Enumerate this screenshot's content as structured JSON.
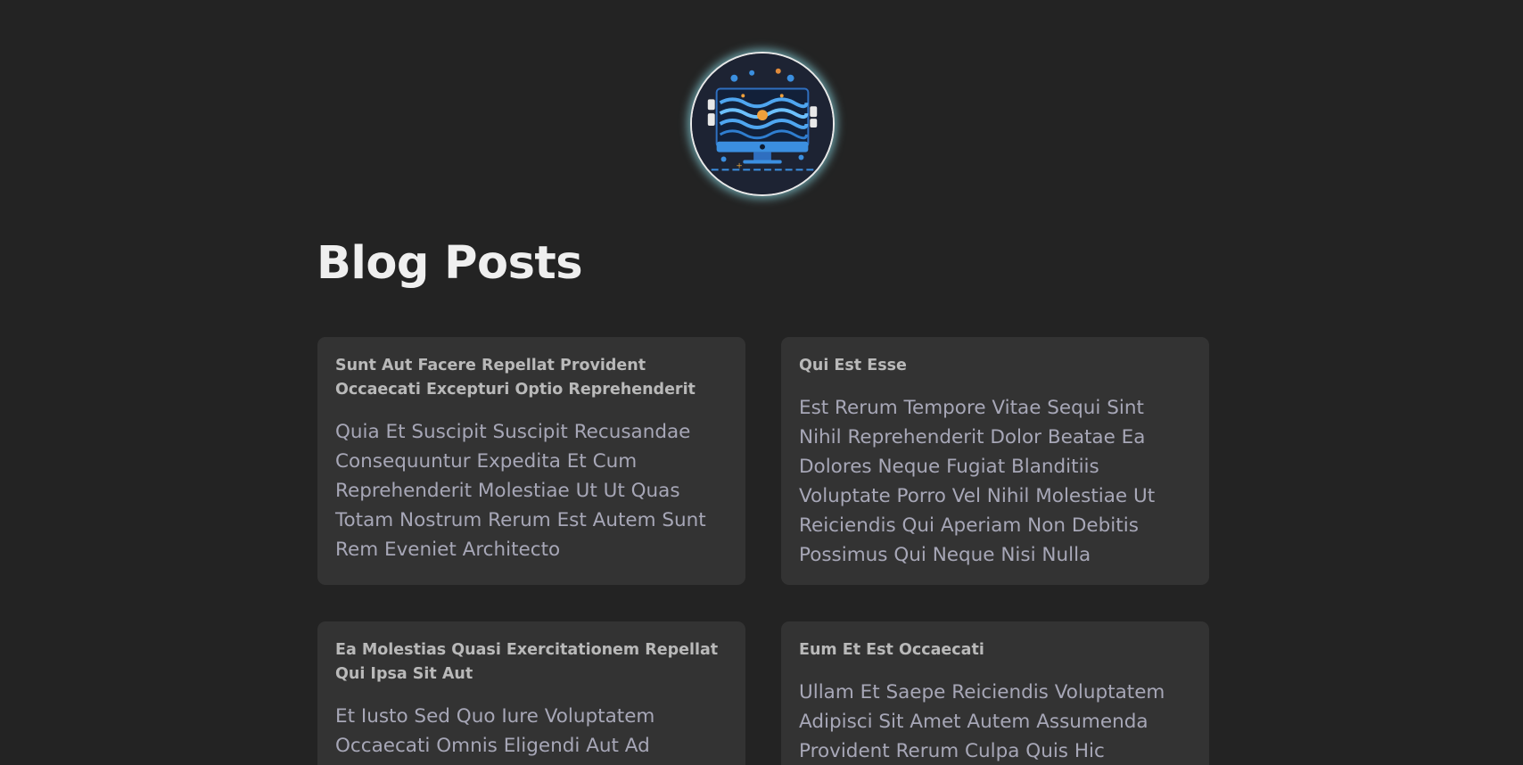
{
  "page": {
    "heading": "Blog Posts"
  },
  "avatar": {
    "icon": "computer-monitor-waves-logo"
  },
  "posts": [
    {
      "title": "Sunt Aut Facere Repellat Provident Occaecati Excepturi Optio Reprehenderit",
      "body": "Quia Et Suscipit Suscipit Recusandae Consequuntur Expedita Et Cum Reprehenderit Molestiae Ut Ut Quas Totam Nostrum Rerum Est Autem Sunt Rem Eveniet Architecto"
    },
    {
      "title": "Qui Est Esse",
      "body": "Est Rerum Tempore Vitae Sequi Sint Nihil Reprehenderit Dolor Beatae Ea Dolores Neque Fugiat Blanditiis Voluptate Porro Vel Nihil Molestiae Ut Reiciendis Qui Aperiam Non Debitis Possimus Qui Neque Nisi Nulla"
    },
    {
      "title": "Ea Molestias Quasi Exercitationem Repellat Qui Ipsa Sit Aut",
      "body": "Et Iusto Sed Quo Iure Voluptatem Occaecati Omnis Eligendi Aut Ad Voluptatem Doloribus"
    },
    {
      "title": "Eum Et Est Occaecati",
      "body": "Ullam Et Saepe Reiciendis Voluptatem Adipisci Sit Amet Autem Assumenda Provident Rerum Culpa Quis Hic Commodi"
    }
  ],
  "colors": {
    "background": "#232323",
    "card": "#333333",
    "heading": "#efefef",
    "title": "#b9b9b9",
    "body": "#a7a7b7",
    "avatar_glow": "#8cdce6"
  }
}
